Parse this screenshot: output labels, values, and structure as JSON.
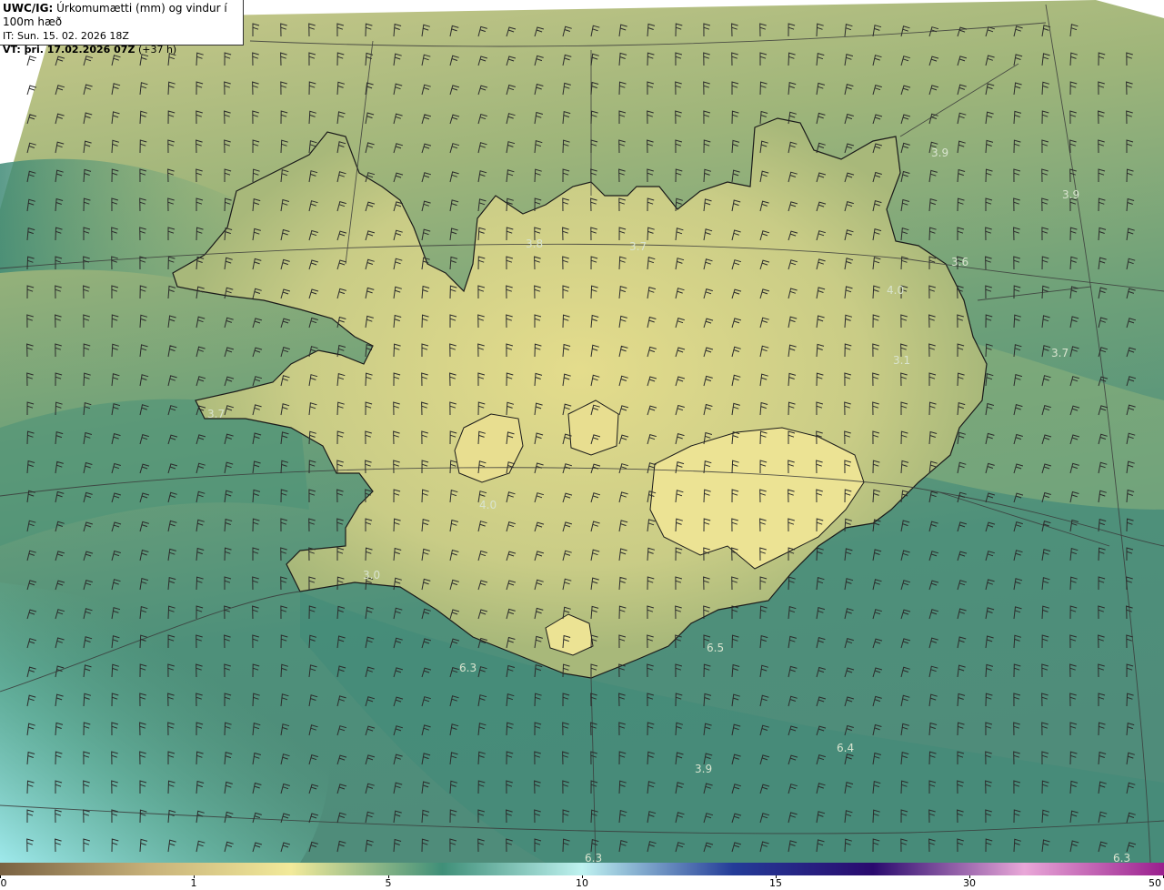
{
  "header": {
    "model": "UWC/IG:",
    "description": "Úrkomumætti (mm) og vindur í 100m hæð",
    "issue_time": "IT: Sun. 15. 02. 2026 18Z",
    "valid_prefix": "VT: þri. 17.02.2026 07Z",
    "valid_suffix": "(+37 h)"
  },
  "map_values": [
    {
      "id": "v1",
      "text": "3.9"
    },
    {
      "id": "v2",
      "text": "3.9"
    },
    {
      "id": "v3",
      "text": "3.8"
    },
    {
      "id": "v4",
      "text": "3.7"
    },
    {
      "id": "v5",
      "text": "3.6"
    },
    {
      "id": "v6",
      "text": "4.0"
    },
    {
      "id": "v7",
      "text": "3.7"
    },
    {
      "id": "v8",
      "text": "3.7"
    },
    {
      "id": "v9",
      "text": "3.1"
    },
    {
      "id": "v10",
      "text": "4.0"
    },
    {
      "id": "v11",
      "text": "3.0"
    },
    {
      "id": "v12",
      "text": "6.3"
    },
    {
      "id": "v13",
      "text": "6.5"
    },
    {
      "id": "v14",
      "text": "6.4"
    },
    {
      "id": "v15",
      "text": "3.9"
    },
    {
      "id": "v16",
      "text": "6.3"
    },
    {
      "id": "v17",
      "text": "6.3"
    }
  ],
  "colorbar": {
    "ticks": [
      {
        "label": "0"
      },
      {
        "label": "1"
      },
      {
        "label": "5"
      },
      {
        "label": "10"
      },
      {
        "label": "15"
      },
      {
        "label": "30"
      },
      {
        "label": "50"
      }
    ],
    "colors": [
      "#7a6242",
      "#c8b27a",
      "#f2ea9a",
      "#3f8f78",
      "#bff2f0",
      "#243c98",
      "#2a0a6e",
      "#e9a7d8",
      "#9a1f8e"
    ]
  }
}
